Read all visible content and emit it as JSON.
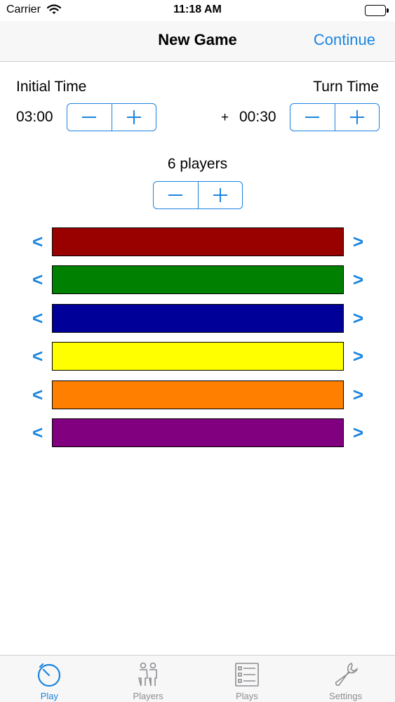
{
  "status": {
    "carrier": "Carrier",
    "time": "11:18 AM"
  },
  "nav": {
    "title": "New Game",
    "continue_label": "Continue"
  },
  "timing": {
    "initial_label": "Initial Time",
    "initial_value": "03:00",
    "turn_label": "Turn Time",
    "turn_prefix": "+",
    "turn_value": "00:30"
  },
  "players": {
    "count_label": "6 players"
  },
  "stepper": {
    "minus": "minus-icon",
    "plus": "plus-icon"
  },
  "arrows": {
    "left": "<",
    "right": ">"
  },
  "colors": [
    "#990000",
    "#008000",
    "#000099",
    "#ffff00",
    "#ff8000",
    "#800080"
  ],
  "accent": "#1a84e0",
  "tabs": [
    {
      "label": "Play",
      "icon": "stopwatch-icon",
      "active": true
    },
    {
      "label": "Players",
      "icon": "players-icon",
      "active": false
    },
    {
      "label": "Plays",
      "icon": "list-icon",
      "active": false
    },
    {
      "label": "Settings",
      "icon": "wrench-icon",
      "active": false
    }
  ]
}
